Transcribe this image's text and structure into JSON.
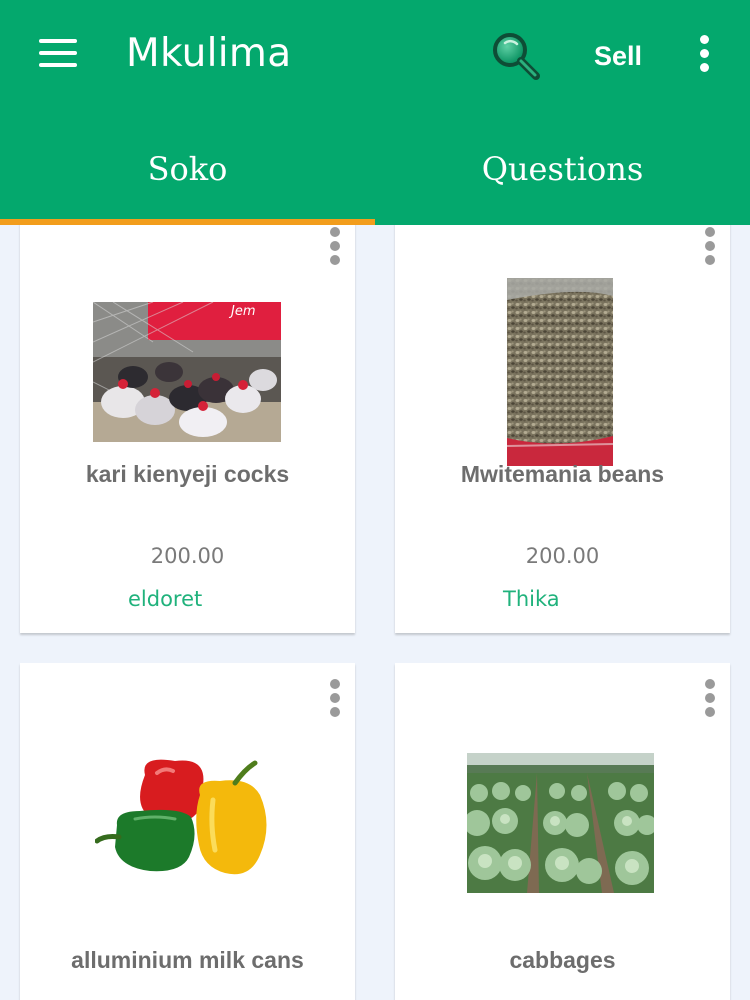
{
  "app": {
    "title": "Mkulima",
    "sell_label": "Sell",
    "icons": [
      "menu-icon",
      "search-icon",
      "more-vert-icon"
    ],
    "colors": {
      "primary": "#04a86d",
      "tab_indicator": "#f29d1c",
      "location_text": "#20b27c",
      "background": "#eef3fb"
    }
  },
  "tabs": [
    {
      "label": "Soko",
      "selected": true
    },
    {
      "label": "Questions",
      "selected": false
    }
  ],
  "products": [
    {
      "name": "kari kienyeji cocks",
      "price": "200.00",
      "location": "eldoret",
      "image": "chickens-photo"
    },
    {
      "name": "Mwitemania beans",
      "price": "200.00",
      "location": "Thika",
      "image": "beans-sack-photo"
    },
    {
      "name": "alluminium milk cans",
      "price": "",
      "location": "",
      "image": "bell-peppers-photo"
    },
    {
      "name": "cabbages",
      "price": "",
      "location": "",
      "image": "cabbage-field-photo"
    }
  ]
}
